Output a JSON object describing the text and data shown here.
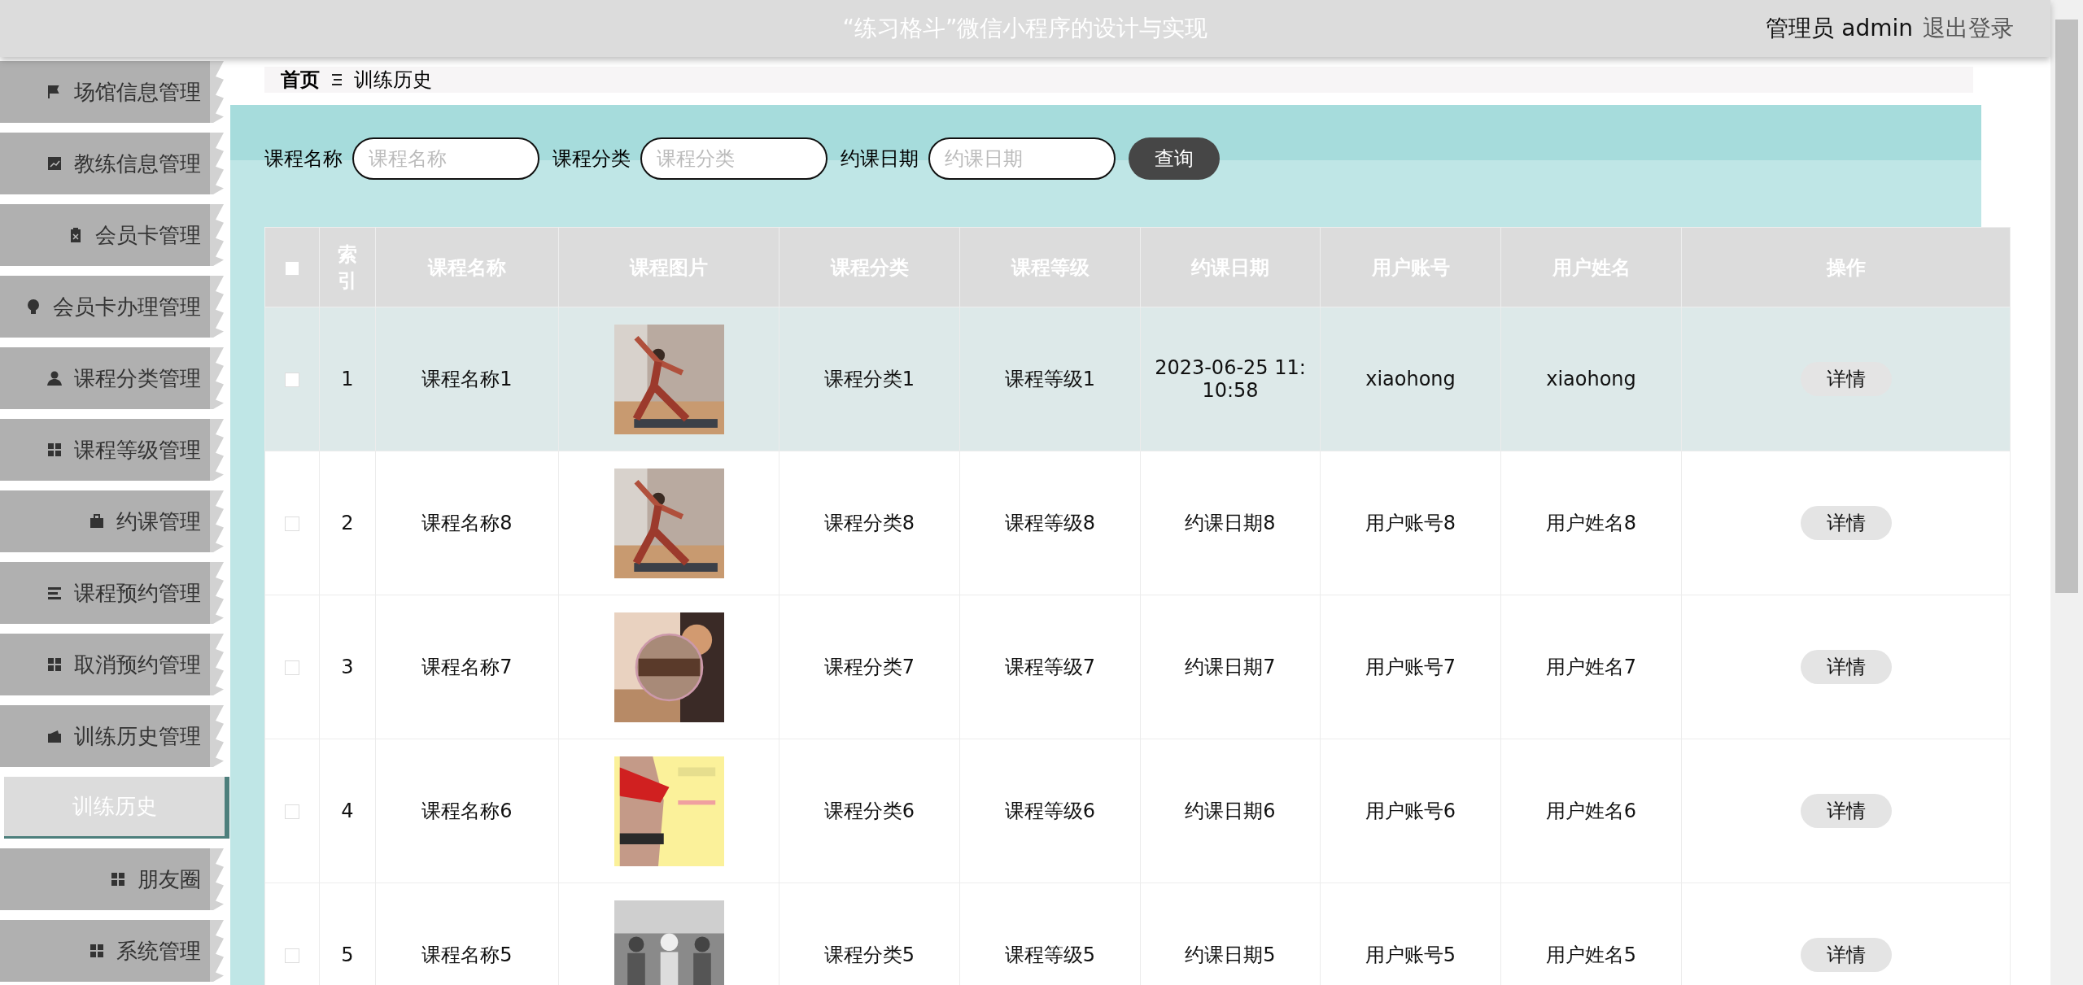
{
  "header": {
    "title": "“练习格斗”微信小程序的设计与实现",
    "user": "管理员 admin",
    "logout": "退出登录"
  },
  "sidebar": {
    "items": [
      {
        "label": "场馆信息管理",
        "kind": "menu",
        "selected": false
      },
      {
        "label": "教练信息管理",
        "kind": "menu",
        "selected": false
      },
      {
        "label": "会员卡管理",
        "kind": "menu",
        "selected": false
      },
      {
        "label": "会员卡办理管理",
        "kind": "menu",
        "selected": false
      },
      {
        "label": "课程分类管理",
        "kind": "menu",
        "selected": false
      },
      {
        "label": "课程等级管理",
        "kind": "menu",
        "selected": false
      },
      {
        "label": "约课管理",
        "kind": "menu",
        "selected": false
      },
      {
        "label": "课程预约管理",
        "kind": "menu",
        "selected": false
      },
      {
        "label": "取消预约管理",
        "kind": "menu",
        "selected": false
      },
      {
        "label": "训练历史管理",
        "kind": "menu",
        "selected": false
      },
      {
        "label": "训练历史",
        "kind": "submenu",
        "selected": true
      },
      {
        "label": "朋友圈",
        "kind": "menu",
        "selected": false
      },
      {
        "label": "系统管理",
        "kind": "menu",
        "selected": false
      }
    ]
  },
  "breadcrumb": {
    "home": "首页",
    "current": "训练历史"
  },
  "search": {
    "fields": [
      {
        "label": "课程名称",
        "placeholder": "课程名称"
      },
      {
        "label": "课程分类",
        "placeholder": "课程分类"
      },
      {
        "label": "约课日期",
        "placeholder": "约课日期"
      }
    ],
    "button": "查询"
  },
  "table": {
    "select_all": {
      "checked": false
    },
    "columns": [
      "索引",
      "课程名称",
      "课程图片",
      "课程分类",
      "课程等级",
      "约课日期",
      "用户账号",
      "用户姓名",
      "操作"
    ],
    "rows": [
      {
        "index": "1",
        "name": "课程名称1",
        "category": "课程分类1",
        "course_level": "课程等级1",
        "date": "2023-06-25 11:10:58",
        "account": "xiaohong",
        "user_name": "xiaohong",
        "action": "详情",
        "checked": false,
        "selected": true
      },
      {
        "index": "2",
        "name": "课程名称8",
        "category": "课程分类8",
        "course_level": "课程等级8",
        "date": "约课日期8",
        "account": "用户账号8",
        "user_name": "用户姓名8",
        "action": "详情",
        "checked": false,
        "selected": false
      },
      {
        "index": "3",
        "name": "课程名称7",
        "category": "课程分类7",
        "course_level": "课程等级7",
        "date": "约课日期7",
        "account": "用户账号7",
        "user_name": "用户姓名7",
        "action": "详情",
        "checked": false,
        "selected": false
      },
      {
        "index": "4",
        "name": "课程名称6",
        "category": "课程分类6",
        "course_level": "课程等级6",
        "date": "约课日期6",
        "account": "用户账号6",
        "user_name": "用户姓名6",
        "action": "详情",
        "checked": false,
        "selected": false
      },
      {
        "index": "5",
        "name": "课程名称5",
        "category": "课程分类5",
        "course_level": "课程等级5",
        "date": "约课日期5",
        "account": "用户账号5",
        "user_name": "用户姓名5",
        "action": "详情",
        "checked": false,
        "selected": false
      }
    ]
  }
}
